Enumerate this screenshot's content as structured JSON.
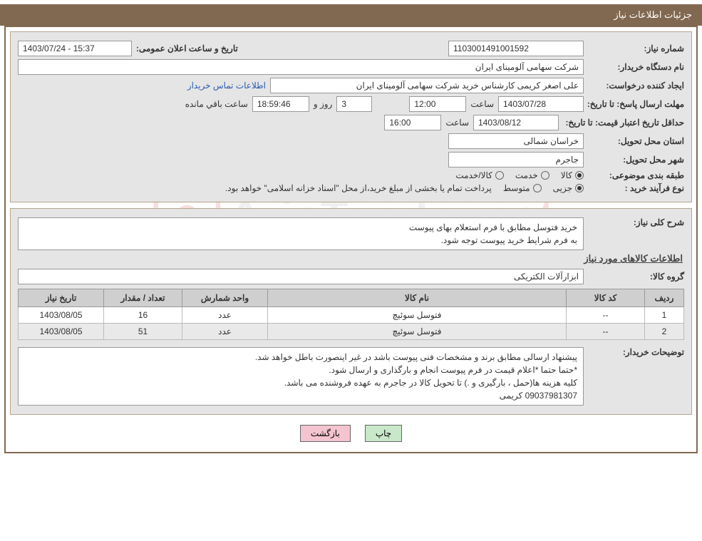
{
  "title_bar": "جزئیات اطلاعات نیاز",
  "labels": {
    "need_no": "شماره نیاز:",
    "announce": "تاریخ و ساعت اعلان عمومی:",
    "buyer_org": "نام دستگاه خریدار:",
    "requester": "ایجاد کننده درخواست:",
    "buyer_contact": "اطلاعات تماس خریدار",
    "reply_deadline": "مهلت ارسال پاسخ: تا تاریخ:",
    "hour": "ساعت",
    "days_and": "روز و",
    "time_left": "ساعت باقي مانده",
    "price_validity": "حداقل تاریخ اعتبار قیمت: تا تاریخ:",
    "province": "استان محل تحویل:",
    "city": "شهر محل تحویل:",
    "subject_class": "طبقه بندی موضوعی:",
    "purchase_type": "نوع فرآیند خرید :",
    "general_desc": "شرح کلی نیاز:",
    "items_head": "اطلاعات کالاهای مورد نیاز",
    "goods_group": "گروه کالا:",
    "buyer_notes": "توضیحات خریدار:"
  },
  "values": {
    "need_no": "1103001491001592",
    "announce": "1403/07/24 - 15:37",
    "buyer_org": "شرکت سهامی آلومینای ایران",
    "requester": "علی اصغر کریمی کارشناس خرید شرکت سهامی آلومینای ایران",
    "reply_date": "1403/07/28",
    "reply_time": "12:00",
    "days": "3",
    "remaining": "18:59:46",
    "price_date": "1403/08/12",
    "price_time": "16:00",
    "province": "خراسان شمالی",
    "city": "جاجرم",
    "payment_note": "پرداخت تمام یا بخشی از مبلغ خرید،از محل \"اسناد خزانه اسلامی\" خواهد بود.",
    "general_desc_1": "خرید فتوسل مطابق با فرم استعلام بهای پیوست",
    "general_desc_2": "به فرم شرایط خرید پیوست توجه شود.",
    "goods_group": "ابزارآلات الکتریکی",
    "buyer_notes_1": "پیشنهاد ارسالی مطابق برند و مشخصات فنی پیوست باشد در غیر اینصورت باطل خواهد شد.",
    "buyer_notes_2": "*حتما حتما *اعلام قیمت در فرم پیوست انجام و بارگذاری و ارسال شود.",
    "buyer_notes_3": "کلیه هزینه ها(حمل ، بارگیری و .) تا تحویل کالا در جاجرم به عهده فروشنده می باشد.",
    "buyer_notes_4": "09037981307 کریمی"
  },
  "class_opts": {
    "goods": "کالا",
    "service": "خدمت",
    "goods_service": "کالا/خدمت"
  },
  "purchase_opts": {
    "partial": "جزیی",
    "medium": "متوسط"
  },
  "table": {
    "headers": {
      "row": "ردیف",
      "code": "کد کالا",
      "name": "نام کالا",
      "unit": "واحد شمارش",
      "qty": "تعداد / مقدار",
      "date": "تاریخ نیاز"
    },
    "rows": [
      {
        "idx": "1",
        "code": "--",
        "name": "فتوسل سوئیچ",
        "unit": "عدد",
        "qty": "16",
        "date": "1403/08/05"
      },
      {
        "idx": "2",
        "code": "--",
        "name": "فتوسل سوئیچ",
        "unit": "عدد",
        "qty": "51",
        "date": "1403/08/05"
      }
    ]
  },
  "buttons": {
    "print": "چاپ",
    "back": "بازگشت"
  },
  "watermark": {
    "left": "Aria",
    "mid": "Tender.",
    "right": "net"
  }
}
